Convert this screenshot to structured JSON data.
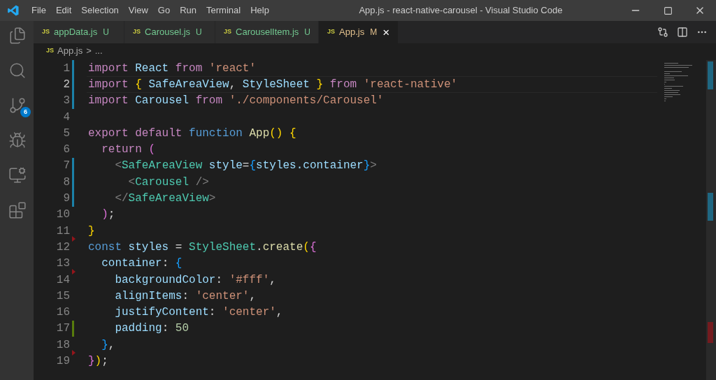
{
  "window": {
    "title": "App.js - react-native-carousel - Visual Studio Code"
  },
  "menu": [
    "File",
    "Edit",
    "Selection",
    "View",
    "Go",
    "Run",
    "Terminal",
    "Help"
  ],
  "activity_bar": [
    {
      "kind": "files",
      "selected": false
    },
    {
      "kind": "search",
      "selected": false
    },
    {
      "kind": "source-control",
      "selected": false,
      "badge": "6"
    },
    {
      "kind": "debug",
      "selected": false
    },
    {
      "kind": "remote",
      "selected": false
    },
    {
      "kind": "extensions",
      "selected": false
    }
  ],
  "tabs": [
    {
      "icon": "JS",
      "label": "appData.js",
      "status": "U",
      "selected": false
    },
    {
      "icon": "JS",
      "label": "Carousel.js",
      "status": "U",
      "selected": false
    },
    {
      "icon": "JS",
      "label": "CarouselItem.js",
      "status": "U",
      "selected": false
    },
    {
      "icon": "JS",
      "label": "App.js",
      "status": "M",
      "selected": true,
      "close": "×"
    }
  ],
  "breadcrumbs": {
    "icon": "JS",
    "file": "App.js",
    "separator": ">",
    "rest": "..."
  },
  "editor": {
    "lines": [
      {
        "number": "1",
        "current": false,
        "modified": true,
        "added": false,
        "deleted": false,
        "tokens": [
          {
            "kind": "keyword",
            "text": "import"
          },
          {
            "kind": "var",
            "text": " React "
          },
          {
            "kind": "keyword",
            "text": "from"
          },
          {
            "kind": "string",
            "text": " 'react'"
          }
        ]
      },
      {
        "number": "2",
        "current": true,
        "modified": true,
        "added": false,
        "deleted": false,
        "tokens": [
          {
            "kind": "keyword",
            "text": "import"
          },
          {
            "kind": "b1",
            "text": " { "
          },
          {
            "kind": "var",
            "text": "SafeAreaView"
          },
          {
            "kind": "punct",
            "text": ", "
          },
          {
            "kind": "var",
            "text": "StyleSheet"
          },
          {
            "kind": "b1",
            "text": " } "
          },
          {
            "kind": "keyword",
            "text": "from"
          },
          {
            "kind": "string",
            "text": " 'react-native'"
          }
        ]
      },
      {
        "number": "3",
        "current": false,
        "modified": true,
        "added": false,
        "deleted": false,
        "tokens": [
          {
            "kind": "keyword",
            "text": "import"
          },
          {
            "kind": "var",
            "text": " Carousel "
          },
          {
            "kind": "keyword",
            "text": "from"
          },
          {
            "kind": "string",
            "text": " './components/Carousel'"
          }
        ]
      },
      {
        "number": "4",
        "current": false,
        "modified": false,
        "added": false,
        "deleted": false
      },
      {
        "number": "5",
        "current": false,
        "modified": false,
        "added": false,
        "deleted": false,
        "tokens": [
          {
            "kind": "keyword",
            "text": "export default "
          },
          {
            "kind": "storage",
            "text": "function "
          },
          {
            "kind": "func",
            "text": "App"
          },
          {
            "kind": "b1",
            "text": "() {"
          }
        ]
      },
      {
        "number": "6",
        "current": false,
        "modified": false,
        "added": false,
        "deleted": false,
        "tokens": [
          {
            "kind": "keyword",
            "text": "  return "
          },
          {
            "kind": "b2",
            "text": "("
          }
        ]
      },
      {
        "number": "7",
        "current": false,
        "modified": true,
        "added": false,
        "deleted": false,
        "tokens": [
          {
            "kind": "tag",
            "text": "    <"
          },
          {
            "kind": "type",
            "text": "SafeAreaView "
          },
          {
            "kind": "var",
            "text": "style"
          },
          {
            "kind": "punct",
            "text": "="
          },
          {
            "kind": "b3",
            "text": "{"
          },
          {
            "kind": "var",
            "text": "styles.container"
          },
          {
            "kind": "b3",
            "text": "}"
          },
          {
            "kind": "tag",
            "text": ">"
          }
        ]
      },
      {
        "number": "8",
        "current": false,
        "modified": true,
        "added": false,
        "deleted": false,
        "tokens": [
          {
            "kind": "tag",
            "text": "      <"
          },
          {
            "kind": "type",
            "text": "Carousel "
          },
          {
            "kind": "tag",
            "text": "/>"
          }
        ]
      },
      {
        "number": "9",
        "current": false,
        "modified": true,
        "added": false,
        "deleted": false,
        "tokens": [
          {
            "kind": "tag",
            "text": "    </"
          },
          {
            "kind": "type",
            "text": "SafeAreaView"
          },
          {
            "kind": "tag",
            "text": ">"
          }
        ]
      },
      {
        "number": "10",
        "current": false,
        "modified": false,
        "added": false,
        "deleted": false,
        "tokens": [
          {
            "kind": "b2",
            "text": "  )"
          },
          {
            "kind": "punct",
            "text": ";"
          }
        ]
      },
      {
        "number": "11",
        "current": false,
        "modified": false,
        "added": false,
        "deleted": false,
        "tokens": [
          {
            "kind": "b1",
            "text": "}"
          }
        ]
      },
      {
        "number": "12",
        "current": false,
        "modified": false,
        "added": false,
        "deleted": true,
        "tokens": [
          {
            "kind": "storage",
            "text": "const "
          },
          {
            "kind": "var",
            "text": "styles "
          },
          {
            "kind": "punct",
            "text": "= "
          },
          {
            "kind": "type",
            "text": "StyleSheet"
          },
          {
            "kind": "punct",
            "text": "."
          },
          {
            "kind": "func",
            "text": "create"
          },
          {
            "kind": "b1",
            "text": "("
          },
          {
            "kind": "b2",
            "text": "{"
          }
        ]
      },
      {
        "number": "13",
        "current": false,
        "modified": false,
        "added": false,
        "deleted": false,
        "tokens": [
          {
            "kind": "var",
            "text": "  container"
          },
          {
            "kind": "punct",
            "text": ": "
          },
          {
            "kind": "b3",
            "text": "{"
          }
        ]
      },
      {
        "number": "14",
        "current": false,
        "modified": false,
        "added": false,
        "deleted": true,
        "tokens": [
          {
            "kind": "var",
            "text": "    backgroundColor"
          },
          {
            "kind": "punct",
            "text": ": "
          },
          {
            "kind": "string",
            "text": "'#fff'"
          },
          {
            "kind": "punct",
            "text": ","
          }
        ]
      },
      {
        "number": "15",
        "current": false,
        "modified": false,
        "added": false,
        "deleted": false,
        "tokens": [
          {
            "kind": "var",
            "text": "    alignItems"
          },
          {
            "kind": "punct",
            "text": ": "
          },
          {
            "kind": "string",
            "text": "'center'"
          },
          {
            "kind": "punct",
            "text": ","
          }
        ]
      },
      {
        "number": "16",
        "current": false,
        "modified": false,
        "added": false,
        "deleted": false,
        "tokens": [
          {
            "kind": "var",
            "text": "    justifyContent"
          },
          {
            "kind": "punct",
            "text": ": "
          },
          {
            "kind": "string",
            "text": "'center'"
          },
          {
            "kind": "punct",
            "text": ","
          }
        ]
      },
      {
        "number": "17",
        "current": false,
        "modified": false,
        "added": true,
        "deleted": false,
        "tokens": [
          {
            "kind": "var",
            "text": "    padding"
          },
          {
            "kind": "punct",
            "text": ": "
          },
          {
            "kind": "number",
            "text": "50"
          }
        ]
      },
      {
        "number": "18",
        "current": false,
        "modified": false,
        "added": false,
        "deleted": false,
        "tokens": [
          {
            "kind": "b3",
            "text": "  }"
          },
          {
            "kind": "punct",
            "text": ","
          }
        ]
      },
      {
        "number": "19",
        "current": false,
        "modified": false,
        "added": false,
        "deleted": true,
        "tokens": [
          {
            "kind": "b2",
            "text": "}"
          },
          {
            "kind": "b1",
            "text": ")"
          },
          {
            "kind": "punct",
            "text": ";"
          }
        ]
      }
    ]
  }
}
